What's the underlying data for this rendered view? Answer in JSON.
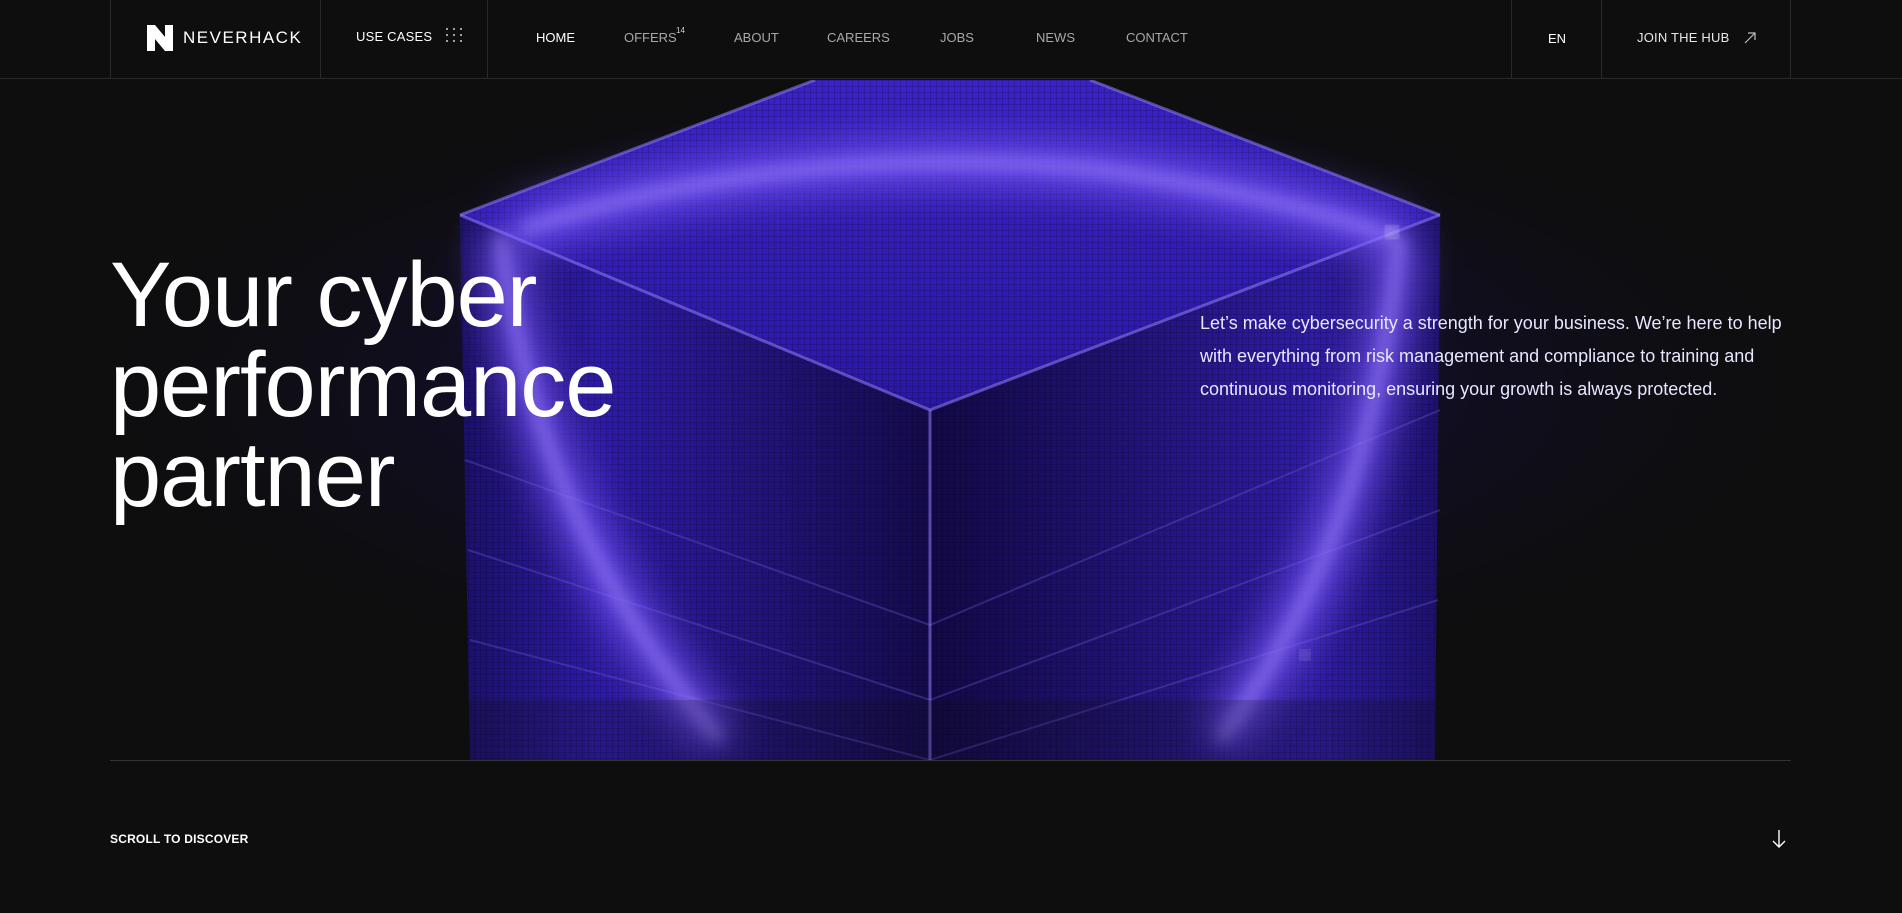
{
  "header": {
    "logo_text": "NEVERHACK",
    "use_cases_label": "USE CASES",
    "nav": [
      {
        "label": "HOME",
        "active": true
      },
      {
        "label": "OFFERS",
        "badge": "14"
      },
      {
        "label": "ABOUT"
      },
      {
        "label": "CAREERS"
      },
      {
        "label": "JOBS"
      },
      {
        "label": "NEWS"
      },
      {
        "label": "CONTACT"
      }
    ],
    "language": "EN",
    "join_label": "JOIN THE HUB"
  },
  "hero": {
    "headline_line1": "Your cyber",
    "headline_line2": "performance",
    "headline_line3": "partner",
    "intro": "Let’s make cybersecurity a strength for your business. We’re here to help with everything from risk management and compliance to training and continuous monitoring, ensuring your growth is always protected."
  },
  "footer_cta": {
    "scroll_label": "SCROLL TO DISCOVER"
  },
  "icons": {
    "logo": "neverhack-logo-icon",
    "use_cases": "dots-grid-icon",
    "join": "arrow-up-right-icon",
    "scroll": "arrow-down-icon"
  },
  "colors": {
    "background": "#0e0e0e",
    "accent": "#5a33ff",
    "glow": "#6f4bff"
  }
}
